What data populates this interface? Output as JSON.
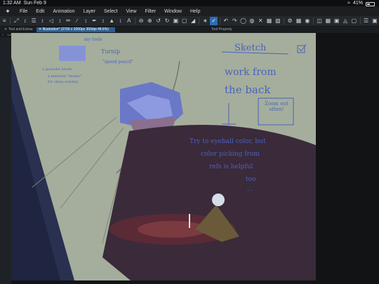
{
  "status": {
    "time": "1:32 AM",
    "date": "Sun Feb 9",
    "battery": "41%",
    "wifi_icon": "wifi-icon",
    "battery_icon": "battery-icon"
  },
  "menu": [
    "File",
    "Edit",
    "Animation",
    "Layer",
    "Select",
    "View",
    "Filter",
    "Window",
    "Help"
  ],
  "tabs": {
    "tool_list": "Tool and Extras",
    "document": "Illustration* (3700 x 3000px 300dpi 48.6%)",
    "tool_property": "Tool Property",
    "sub_tool": "Sub",
    "tool_label": "Tool"
  },
  "canvas": {
    "color_swatch_label": "my tools",
    "brush_name": "Turnip",
    "brush_quote": "\"speed pencil\"",
    "gouache_note": "a gouache brush",
    "eraser_note1": "a textured \"eraser\"",
    "eraser_note2": "for clean erasing",
    "sketch_word": "Sketch",
    "work_from": "work from",
    "the_back": "the back",
    "zoom_out": "Zoom out often!",
    "eyeball1": "Try to eyeball color, but",
    "eyeball2": "color picking from",
    "eyeball3": "refs is helpful",
    "eyeball4": "too",
    "sweat": "- -"
  },
  "colors": {
    "canvas_bg": "#a5ae9c",
    "ink": "#4b62bd",
    "accent": "#2e6db3",
    "table": "#3a2a3a"
  }
}
